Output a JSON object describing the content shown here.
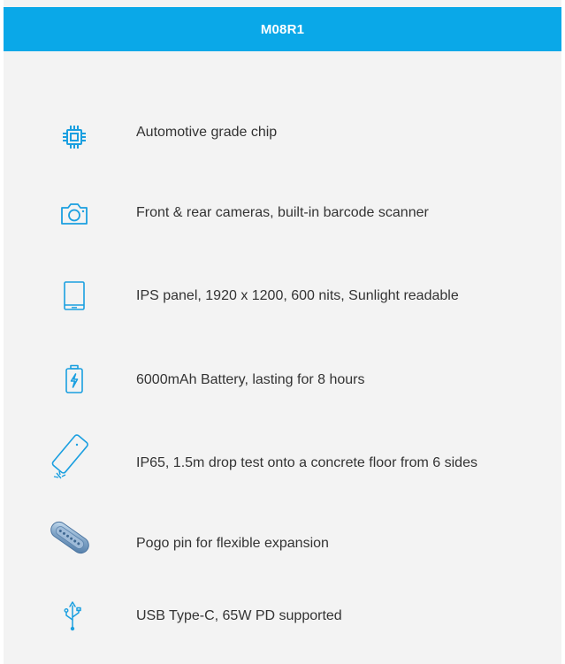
{
  "header": {
    "title": "M08R1"
  },
  "features": [
    {
      "icon": "chip-icon",
      "text": "Automotive grade chip"
    },
    {
      "icon": "camera-icon",
      "text": "Front & rear cameras, built-in barcode scanner"
    },
    {
      "icon": "tablet-icon",
      "text": "IPS panel, 1920 x 1200, 600 nits, Sunlight readable"
    },
    {
      "icon": "battery-icon",
      "text": "6000mAh Battery, lasting for 8 hours"
    },
    {
      "icon": "drop-test-icon",
      "text": "IP65, 1.5m drop test onto a concrete floor from 6 sides"
    },
    {
      "icon": "pogo-pin-icon",
      "text": "Pogo pin for flexible expansion"
    },
    {
      "icon": "usb-icon",
      "text": "USB Type-C, 65W PD supported"
    }
  ],
  "colors": {
    "accent": "#0aa8e8",
    "background": "#f3f3f3",
    "text": "#333333",
    "icon": "#1a9fe0"
  }
}
